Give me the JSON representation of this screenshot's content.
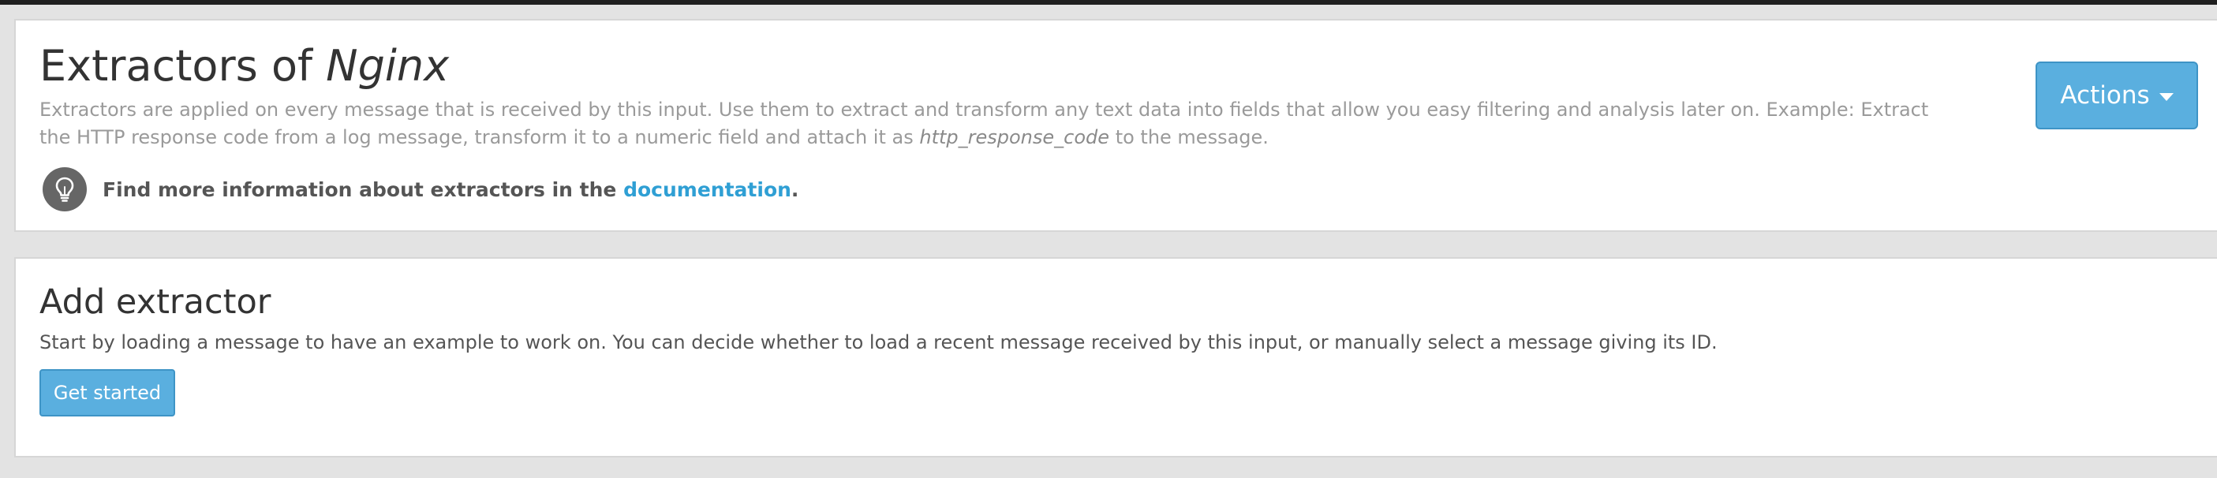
{
  "header": {
    "title_prefix": "Extractors of",
    "input_name": "Nginx",
    "description_part1": "Extractors are applied on every message that is received by this input. Use them to extract and transform any text data into fields that allow you easy filtering and analysis later on. Example: Extract the HTTP response code from a log message, transform it to a numeric field and attach it as",
    "description_field": "http_response_code",
    "description_part2": "to the message.",
    "info_text": "Find more information about extractors in the",
    "info_link": "documentation",
    "info_end": ".",
    "actions_label": "Actions",
    "bulb_icon": "lightbulb-icon",
    "caret_icon": "caret-down-icon"
  },
  "add_extractor": {
    "title": "Add extractor",
    "text": "Start by loading a message to have an example to work on. You can decide whether to load a recent message received by this input, or manually select a message giving its ID.",
    "button_label": "Get started"
  },
  "colors": {
    "primary": "#5aafdf",
    "link": "#2f9fd4",
    "background": "#e3e3e3",
    "topbar": "#1f1f1f"
  }
}
